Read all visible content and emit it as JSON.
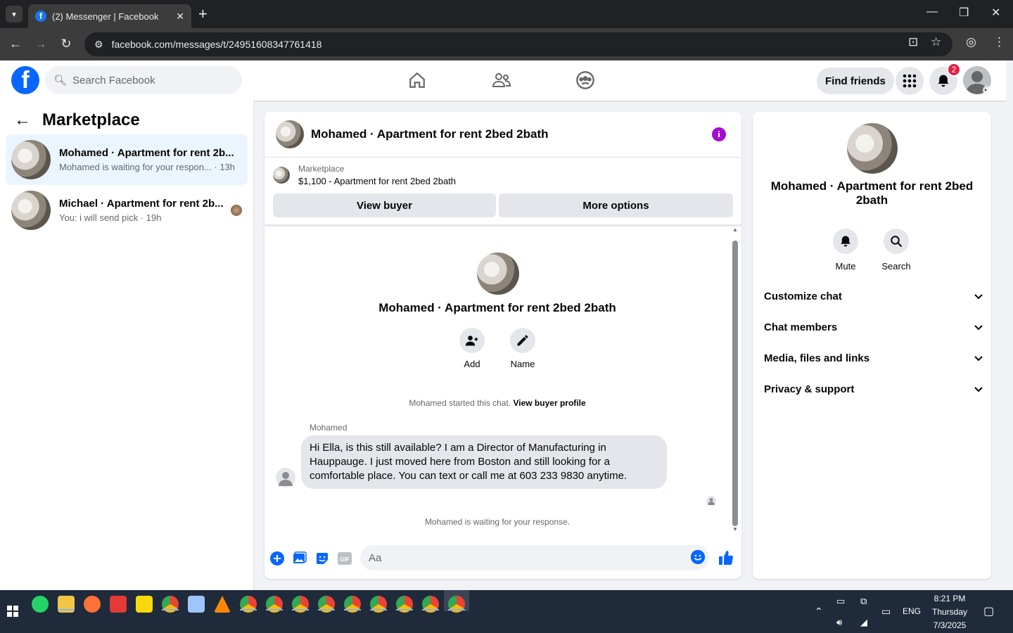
{
  "browser": {
    "tab_title": "(2) Messenger | Facebook",
    "url": "facebook.com/messages/t/24951608347761418"
  },
  "header": {
    "search_placeholder": "Search Facebook",
    "find_friends": "Find friends",
    "notifications_count": "2"
  },
  "sidebar": {
    "title": "Marketplace",
    "conversations": [
      {
        "name": "Mohamed · Apartment for rent 2b...",
        "preview": "Mohamed is waiting for your respon... · 13h"
      },
      {
        "name": "Michael · Apartment for rent 2b...",
        "preview": "You: i will send pick · 19h"
      }
    ]
  },
  "chat": {
    "title": "Mohamed · Apartment for rent 2bed 2bath",
    "listing_label": "Marketplace",
    "listing_value": "$1,100 - Apartment for rent 2bed 2bath",
    "view_buyer": "View buyer",
    "more_options": "More options",
    "body_title": "Mohamed · Apartment for rent 2bed 2bath",
    "add_label": "Add",
    "name_label": "Name",
    "started_text": "Mohamed started this chat.",
    "view_buyer_profile": "View buyer profile",
    "sender": "Mohamed",
    "message": "Hi Ella, is this still available? I am a Director of Manufacturing in Hauppauge. I just moved here from Boston and still looking for a comfortable place. You can text or call me at 603 233 9830 anytime.",
    "waiting": "Mohamed is waiting for your response.",
    "input_placeholder": "Aa"
  },
  "details": {
    "name": "Mohamed · Apartment for rent 2bed 2bath",
    "mute": "Mute",
    "search": "Search",
    "sections": [
      "Customize chat",
      "Chat members",
      "Media, files and links",
      "Privacy & support"
    ]
  },
  "taskbar": {
    "time": "8:21 PM",
    "day": "Thursday",
    "date": "7/3/2025",
    "lang": "ENG"
  },
  "colors": {
    "brand": "#0866ff",
    "accent_purple": "#a20ed1",
    "active_conv": "#ebf5ff"
  }
}
